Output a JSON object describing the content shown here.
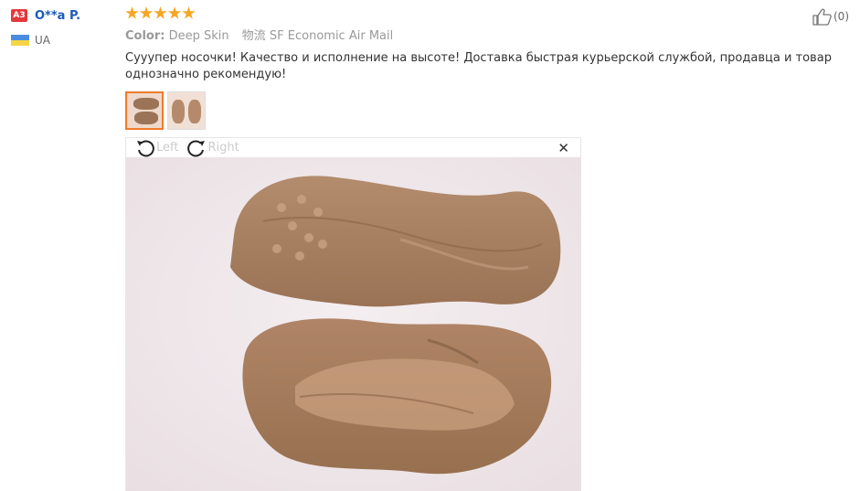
{
  "user": {
    "level_badge": "A3",
    "name": "O**a P.",
    "country": "UA"
  },
  "rating": {
    "stars": 5
  },
  "meta": {
    "color_label": "Color:",
    "color_value": "Deep Skin",
    "shipping": "物流 SF Economic Air Mail"
  },
  "review": {
    "text": "Сууупер носочки! Качество и исполнение на высоте! Доставка быстрая курьерской службой, продавца и товар однозначно рекомендую!"
  },
  "viewer": {
    "rotate_left_label": "Left",
    "rotate_right_label": "Right",
    "close_label": "✕"
  },
  "helpful": {
    "count": "(0)"
  },
  "colors": {
    "star": "#f5a623",
    "badge": "#e4393c",
    "username": "#1a5ab5",
    "thumb_active_border": "#f07b2a"
  },
  "icons": [
    "thumbs-up-icon",
    "rotate-left-icon",
    "rotate-right-icon",
    "close-icon",
    "star-icon",
    "flag-icon"
  ]
}
